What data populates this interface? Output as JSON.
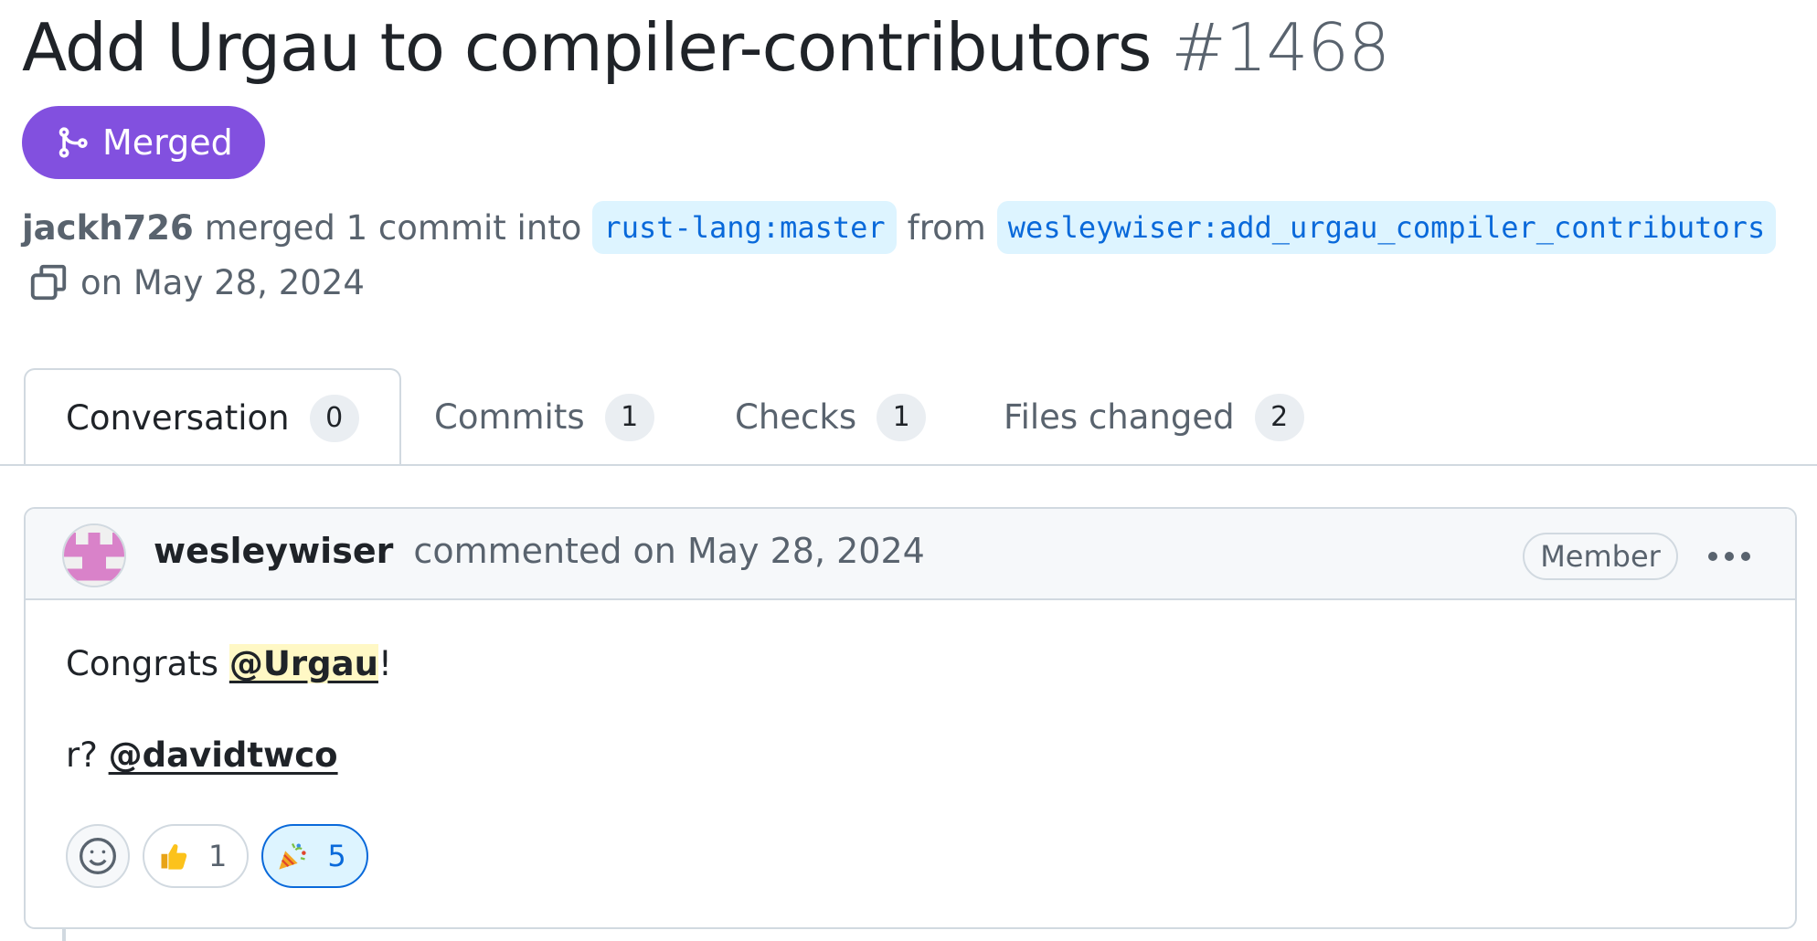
{
  "pr": {
    "title": "Add Urgau to compiler-contributors",
    "number": "#1468",
    "state": "Merged",
    "author": "jackh726",
    "merge_text": "merged 1 commit into",
    "base_branch": "rust-lang:master",
    "from_text": "from",
    "head_branch": "wesleywiser:add_urgau_compiler_contributors",
    "date_text": "on May 28, 2024"
  },
  "tabs": [
    {
      "label": "Conversation",
      "count": "0"
    },
    {
      "label": "Commits",
      "count": "1"
    },
    {
      "label": "Checks",
      "count": "1"
    },
    {
      "label": "Files changed",
      "count": "2"
    }
  ],
  "comment": {
    "author": "wesleywiser",
    "action": "commented on May 28, 2024",
    "role": "Member",
    "line1_prefix": "Congrats ",
    "line1_mention": "@Urgau",
    "line1_suffix": "!",
    "line2_prefix": "r? ",
    "line2_mention": "@davidtwco"
  },
  "reactions": [
    {
      "icon": "thumbs-up-icon",
      "count": "1",
      "active": false
    },
    {
      "icon": "party-popper-icon",
      "count": "5",
      "active": true
    }
  ],
  "colors": {
    "merged": "#8250df",
    "link": "#0969da",
    "branch_bg": "#ddf4ff",
    "border": "#d1d9e0",
    "muted": "#59636e"
  },
  "icons": [
    "git-merge-icon",
    "copy-icon",
    "avatar-identicon",
    "kebab-menu-icon",
    "smiley-add-reaction-icon"
  ]
}
